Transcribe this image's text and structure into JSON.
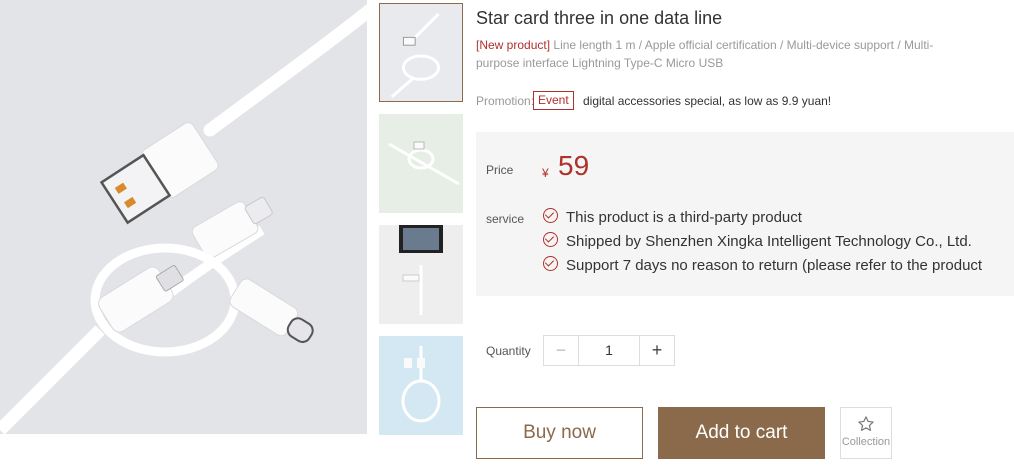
{
  "product": {
    "title": "Star card three in one data line",
    "desc_tag": "[New product]",
    "desc_text": "Line length 1 m / Apple official certification / Multi-device support / Multi-purpose interface Lightning Type-C Micro USB",
    "promotion_label": "Promotion:",
    "event_badge": "Event",
    "promotion_text": "digital accessories special, as low as 9.9 yuan!"
  },
  "price": {
    "label": "Price",
    "currency": "¥",
    "value": "59"
  },
  "service": {
    "label": "service",
    "items": [
      "This product is a third-party product",
      "Shipped by Shenzhen Xingka Intelligent Technology Co., Ltd.",
      "Support 7 days no reason to return (please refer to the product"
    ]
  },
  "quantity": {
    "label": "Quantity",
    "value": "1",
    "minus": "−",
    "plus": "+"
  },
  "actions": {
    "buy_now": "Buy now",
    "add_to_cart": "Add to cart",
    "collection": "Collection"
  },
  "colors": {
    "accent": "#8b6a4b",
    "price": "#b0302b"
  }
}
